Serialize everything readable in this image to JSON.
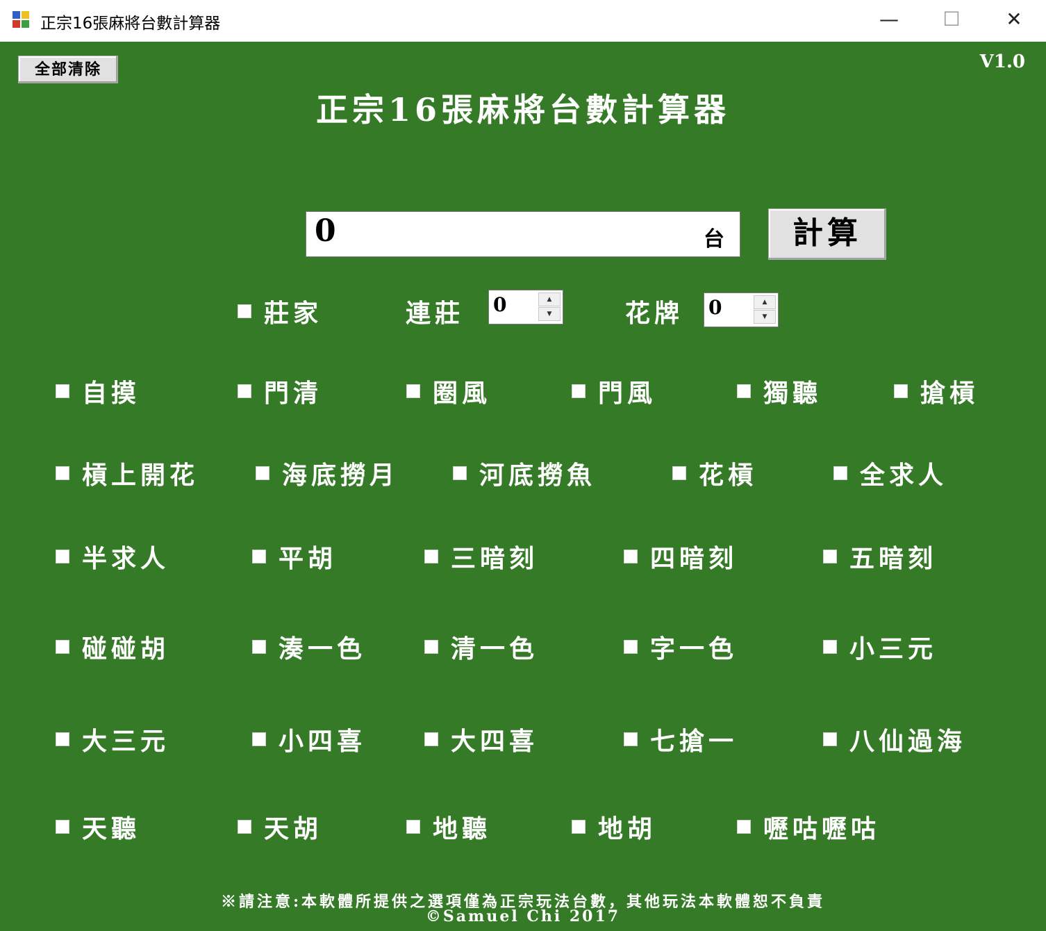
{
  "window": {
    "title": "正宗16張麻將台數計算器",
    "minimize_glyph": "—",
    "maximize_glyph": "☐",
    "close_glyph": "✕"
  },
  "toolbar": {
    "clear_all_label": "全部清除",
    "version": "V1.0"
  },
  "heading": "正宗16張麻將台數計算器",
  "result": {
    "value": "0",
    "unit": "台",
    "calculate_label": "計算"
  },
  "dealer": {
    "dealer_label": "莊家",
    "consecutive_label": "連莊",
    "consecutive_value": "0",
    "flowers_label": "花牌",
    "flowers_value": "0"
  },
  "options": [
    [
      "自摸",
      "門清",
      "圈風",
      "門風",
      "獨聽",
      "搶槓"
    ],
    [
      "槓上開花",
      "海底撈月",
      "河底撈魚",
      "花槓",
      "全求人"
    ],
    [
      "半求人",
      "平胡",
      "三暗刻",
      "四暗刻",
      "五暗刻"
    ],
    [
      "碰碰胡",
      "湊一色",
      "清一色",
      "字一色",
      "小三元"
    ],
    [
      "大三元",
      "小四喜",
      "大四喜",
      "七搶一",
      "八仙過海"
    ],
    [
      "天聽",
      "天胡",
      "地聽",
      "地胡",
      "嚦咕嚦咕"
    ]
  ],
  "footer": {
    "disclaimer": "※請注意:本軟體所提供之選項僅為正宗玩法台數，其他玩法本軟體恕不負責",
    "copyright": "©Samuel Chi 2017"
  },
  "colors": {
    "background": "#357a26",
    "text": "#ffffff",
    "button": "#e1e1e1"
  }
}
